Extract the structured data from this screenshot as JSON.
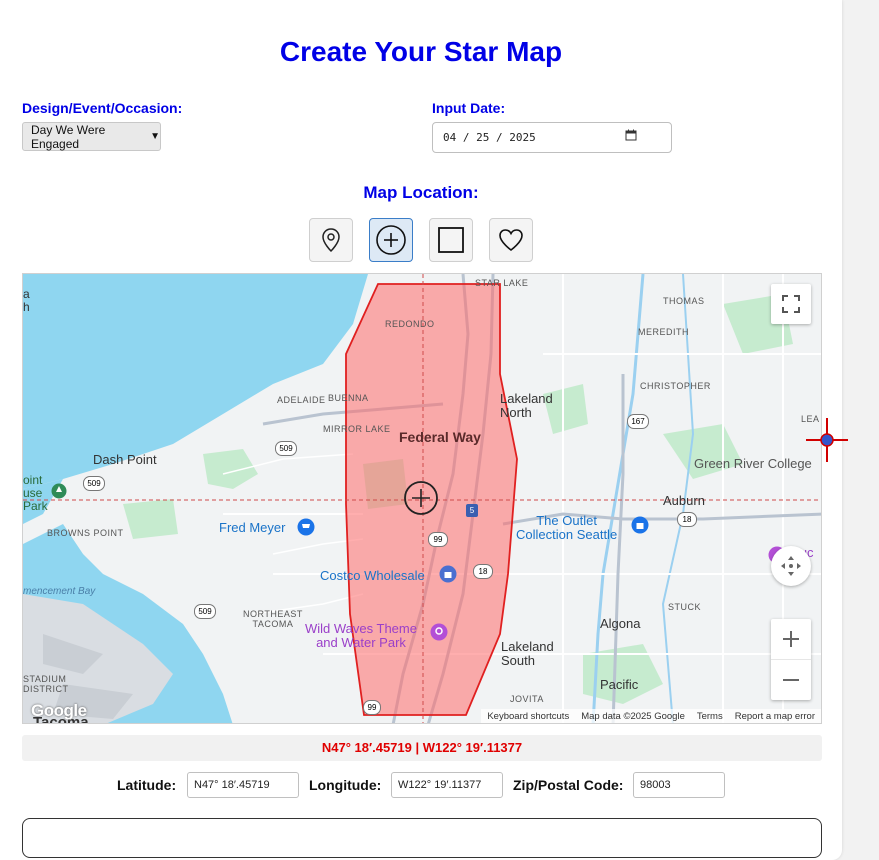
{
  "page": {
    "title": "Create Your Star Map"
  },
  "design": {
    "label": "Design/Event/Occasion:",
    "selected": "Day We Were Engaged"
  },
  "date": {
    "label": "Input Date:",
    "value": "04 / 25 / 2025"
  },
  "map_location": {
    "label": "Map Location:",
    "shape_buttons": [
      {
        "name": "pin",
        "icon": "map-pin-icon",
        "active": false
      },
      {
        "name": "crosshair",
        "icon": "crosshair-circle-icon",
        "active": true
      },
      {
        "name": "square",
        "icon": "square-icon",
        "active": false
      },
      {
        "name": "heart",
        "icon": "heart-icon",
        "active": false
      }
    ]
  },
  "map": {
    "labels": {
      "star_lake": "STAR LAKE",
      "thomas": "THOMAS",
      "redondo": "REDONDO",
      "meredith": "MEREDITH",
      "christopher": "CHRISTOPHER",
      "adelaide": "ADELAIDE",
      "buenna": "BUENNA",
      "mirror_lake": "MIRROR LAKE",
      "lea": "LEA",
      "browns_point": "BROWNS POINT",
      "northeast_tacoma": "NORTHEAST\nTACOMA",
      "stuck": "STUCK",
      "jovita": "JOVITA",
      "stadium_district": "STADIUM\nDISTRICT"
    },
    "cities": {
      "federal_way": "Federal Way",
      "lakeland_north": "Lakeland\nNorth",
      "dash_point": "Dash Point",
      "green_river": "Green River College",
      "auburn": "Auburn",
      "algona": "Algona",
      "pacific": "Pacific",
      "lakeland_south": "Lakeland\nSouth",
      "tacoma": "Tacoma",
      "point_park": "oint\nuse\nPark",
      "left_edge": "a\nh"
    },
    "pois": {
      "fred_meyer": "Fred Meyer",
      "outlet": "The Outlet\nCollection Seattle",
      "costco": "Costco Wholesale",
      "wild_waves": "Wild Waves Theme\nand Water Park",
      "museum": "Muc\nsi"
    },
    "water_labels": {
      "commencement_bay": "mencement Bay"
    },
    "routes": [
      "509",
      "509",
      "167",
      "5",
      "99",
      "18",
      "18",
      "509",
      "99"
    ],
    "footer": {
      "shortcuts": "Keyboard shortcuts",
      "data": "Map data ©2025 Google",
      "terms": "Terms",
      "report": "Report a map error"
    },
    "logo": "Google",
    "colors": {
      "water": "#8fd6f0",
      "land": "#f1f3f4",
      "park": "#c6ebcf",
      "polygon_fill": "#ff6b6b",
      "polygon_stroke": "#e02020"
    }
  },
  "coordinates": {
    "display": "N47° 18′.45719 | W122° 19′.11377",
    "latitude_label": "Latitude:",
    "latitude": "N47° 18′.45719",
    "longitude_label": "Longitude:",
    "longitude": "W122° 19′.11377",
    "zip_label": "Zip/Postal Code:",
    "zip": "98003"
  }
}
